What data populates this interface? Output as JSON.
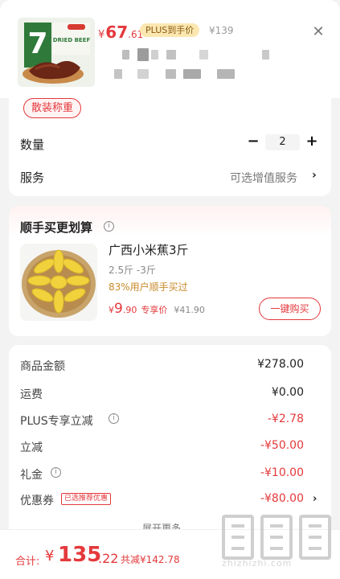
{
  "product": {
    "price_symbol": "¥",
    "price_int": "67",
    "price_dec": ".61",
    "plus_badge": "PLUS到手价",
    "original_price": "¥139",
    "image_label": "DRIED BEEF",
    "image_number": "7"
  },
  "options": {
    "weight_chip": "散装称重",
    "quantity_label": "数量",
    "quantity_value": "2",
    "minus": "−",
    "plus": "+",
    "service_label": "服务",
    "service_link": "可选增值服务",
    "chevron": "›"
  },
  "addon": {
    "title": "顺手买更划算",
    "info": "i",
    "name": "广西小米蕉3斤",
    "spec": "2.5斤 -3斤",
    "popularity": "83%用户顺手买过",
    "price_symbol": "¥",
    "price_int": "9",
    "price_dec": ".90",
    "price_tag": "专享价",
    "original_price": "¥41.90",
    "buy_button": "一键购买"
  },
  "summary": {
    "rows": [
      {
        "label": "商品金额",
        "value": "¥278.00"
      },
      {
        "label": "运费",
        "value": "¥0.00"
      },
      {
        "label": "PLUS专享立减",
        "value": "-¥2.78"
      },
      {
        "label": "立减",
        "value": "-¥50.00"
      },
      {
        "label": "礼金",
        "value": "-¥10.00"
      },
      {
        "label": "优惠券",
        "value": "-¥80.00"
      }
    ],
    "coupon_badge": "已选推荐优惠",
    "expand": "展开更多 ⌄"
  },
  "footer": {
    "total_label": "合计:",
    "total_symbol": "¥",
    "total_int": "135",
    "total_dec": ".22",
    "total_saving": "共减¥142.78"
  },
  "watermark": {
    "glyphs": "值值值",
    "text": "zhizhizhi.com"
  },
  "colors": {
    "accent": "#e4393c",
    "plus_badge_bg": "#fbe7b0",
    "popularity": "#c98a2a"
  }
}
